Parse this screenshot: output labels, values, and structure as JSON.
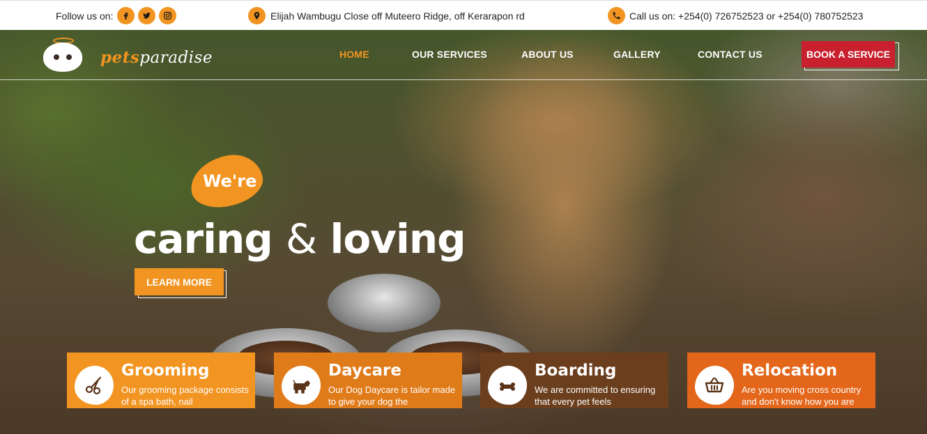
{
  "topbar": {
    "follow_label": "Follow us on:",
    "social_icons": [
      "facebook-icon",
      "twitter-icon",
      "instagram-icon"
    ],
    "address": "Elijah Wambugu Close off Muteero Ridge, off Kerarapon rd",
    "phone": "Call us on: +254(0) 726752523 or +254(0) 780752523"
  },
  "brand": {
    "name_part1": "pets",
    "name_part2": "paradise",
    "accent_color": "#f29421",
    "cta_color": "#c8202e"
  },
  "nav": {
    "items": [
      "HOME",
      "OUR SERVICES",
      "ABOUT US",
      "GALLERY",
      "CONTACT US"
    ],
    "active": "HOME",
    "cta": "BOOK A SERVICE"
  },
  "hero": {
    "tag": "We're",
    "headline_part1": "caring",
    "headline_amp": "&",
    "headline_part2": "loving",
    "button": "LEARN MORE"
  },
  "services": [
    {
      "title": "Grooming",
      "desc": "Our grooming package consists of a spa bath, nail",
      "icon": "scissors-icon",
      "color": "#f29421"
    },
    {
      "title": "Daycare",
      "desc": "Our Dog Daycare is tailor made to give your dog the",
      "icon": "dog-icon",
      "color": "#e07b1a"
    },
    {
      "title": "Boarding",
      "desc": "We are committed to ensuring that every pet feels",
      "icon": "bone-icon",
      "color": "#6b3f1d"
    },
    {
      "title": "Relocation",
      "desc": "Are you moving cross country and don't know how you are",
      "icon": "basket-icon",
      "color": "#e3661a"
    }
  ]
}
